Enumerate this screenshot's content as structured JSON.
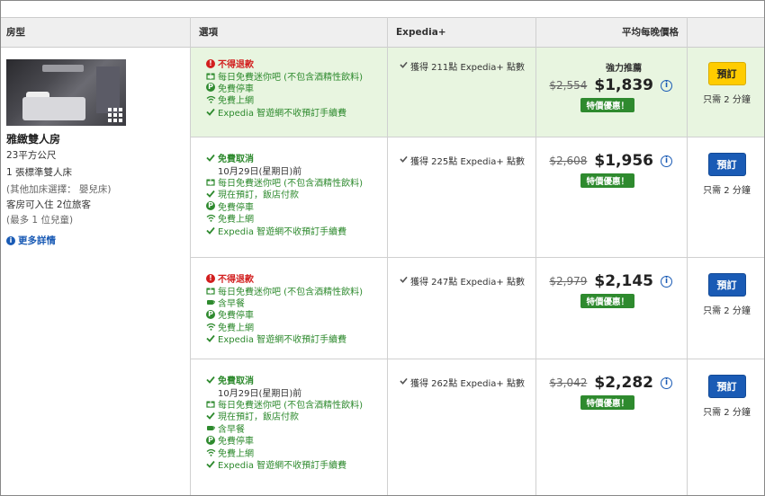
{
  "header": {
    "room_type": "房型",
    "options": "選項",
    "expedia": "Expedia+",
    "avg_price": "平均每晚價格"
  },
  "room": {
    "name": "雅緻雙人房",
    "size": "23平方公尺",
    "bed": "1 張標準雙人床",
    "extra_bed": "(其他加床選擇： 嬰兒床)",
    "occupancy": "客房可入住 2位旅客",
    "children": "(最多 1 位兒童)",
    "more_details": "更多詳情"
  },
  "rates": [
    {
      "highlight": true,
      "options": [
        {
          "icon": "exclamation-icon",
          "text": "不得退款",
          "style": "red"
        },
        {
          "icon": "gift-icon",
          "text": "每日免費迷你吧 (不包含酒精性飲料)",
          "style": "green"
        },
        {
          "icon": "parking-icon",
          "text": "免費停車",
          "style": "green"
        },
        {
          "icon": "wifi-icon",
          "text": "免費上網",
          "style": "green"
        },
        {
          "icon": "check-icon",
          "text": "Expedia 智遊網不收預訂手續費",
          "style": "green"
        }
      ],
      "points": "獲得 211點 Expedia+ 點數",
      "recommend": "強力推薦",
      "old_price": "$2,554",
      "new_price": "$1,839",
      "deal": "特價優惠！",
      "button": "預訂",
      "button_style": "yellow",
      "note": "只需 2 分鐘"
    },
    {
      "highlight": false,
      "options": [
        {
          "icon": "check-icon",
          "text": "免費取消",
          "style": "green-bold"
        },
        {
          "icon": "",
          "text": "10月29日(星期日)前",
          "style": "plain"
        },
        {
          "icon": "gift-icon",
          "text": "每日免費迷你吧 (不包含酒精性飲料)",
          "style": "green"
        },
        {
          "icon": "check-icon",
          "text": "現在預訂，飯店付款",
          "style": "green"
        },
        {
          "icon": "parking-icon",
          "text": "免費停車",
          "style": "green"
        },
        {
          "icon": "wifi-icon",
          "text": "免費上網",
          "style": "green"
        },
        {
          "icon": "check-icon",
          "text": "Expedia 智遊網不收預訂手續費",
          "style": "green"
        }
      ],
      "points": "獲得 225點 Expedia+ 點數",
      "recommend": "",
      "old_price": "$2,608",
      "new_price": "$1,956",
      "deal": "特價優惠！",
      "button": "預訂",
      "button_style": "blue",
      "note": "只需 2 分鐘"
    },
    {
      "highlight": false,
      "options": [
        {
          "icon": "exclamation-icon",
          "text": "不得退款",
          "style": "red"
        },
        {
          "icon": "gift-icon",
          "text": "每日免費迷你吧 (不包含酒精性飲料)",
          "style": "green"
        },
        {
          "icon": "coffee-icon",
          "text": "含早餐",
          "style": "green"
        },
        {
          "icon": "parking-icon",
          "text": "免費停車",
          "style": "green"
        },
        {
          "icon": "wifi-icon",
          "text": "免費上網",
          "style": "green"
        },
        {
          "icon": "check-icon",
          "text": "Expedia 智遊網不收預訂手續費",
          "style": "green"
        }
      ],
      "points": "獲得 247點 Expedia+ 點數",
      "recommend": "",
      "old_price": "$2,979",
      "new_price": "$2,145",
      "deal": "特價優惠！",
      "button": "預訂",
      "button_style": "blue",
      "note": "只需 2 分鐘"
    },
    {
      "highlight": false,
      "options": [
        {
          "icon": "check-icon",
          "text": "免費取消",
          "style": "green-bold"
        },
        {
          "icon": "",
          "text": "10月29日(星期日)前",
          "style": "plain"
        },
        {
          "icon": "gift-icon",
          "text": "每日免費迷你吧 (不包含酒精性飲料)",
          "style": "green"
        },
        {
          "icon": "check-icon",
          "text": "現在預訂，飯店付款",
          "style": "green"
        },
        {
          "icon": "coffee-icon",
          "text": "含早餐",
          "style": "green"
        },
        {
          "icon": "parking-icon",
          "text": "免費停車",
          "style": "green"
        },
        {
          "icon": "wifi-icon",
          "text": "免費上網",
          "style": "green"
        },
        {
          "icon": "check-icon",
          "text": "Expedia 智遊網不收預訂手續費",
          "style": "green"
        }
      ],
      "points": "獲得 262點 Expedia+ 點數",
      "recommend": "",
      "old_price": "$3,042",
      "new_price": "$2,282",
      "deal": "特價優惠！",
      "button": "預訂",
      "button_style": "blue",
      "note": "只需 2 分鐘"
    }
  ]
}
